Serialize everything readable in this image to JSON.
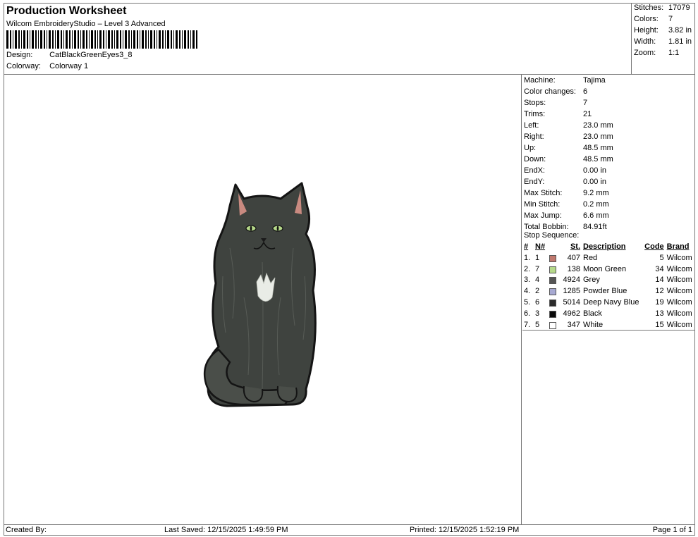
{
  "header": {
    "title": "Production Worksheet",
    "subtitle": "Wilcom EmbroideryStudio – Level 3 Advanced",
    "design_label": "Design:",
    "design_value": "CatBlackGreenEyes3_8",
    "colorway_label": "Colorway:",
    "colorway_value": "Colorway 1"
  },
  "summary": [
    {
      "label": "Stitches:",
      "value": "17079"
    },
    {
      "label": "Colors:",
      "value": "7"
    },
    {
      "label": "Height:",
      "value": "3.82 in"
    },
    {
      "label": "Width:",
      "value": "1.81 in"
    },
    {
      "label": "Zoom:",
      "value": "1:1"
    }
  ],
  "machine_info": [
    {
      "label": "Machine:",
      "value": "Tajima"
    },
    {
      "label": "Color changes:",
      "value": "6"
    },
    {
      "label": "Stops:",
      "value": "7"
    },
    {
      "label": "Trims:",
      "value": "21"
    },
    {
      "label": "Left:",
      "value": "23.0 mm"
    },
    {
      "label": "Right:",
      "value": "23.0 mm"
    },
    {
      "label": "Up:",
      "value": "48.5 mm"
    },
    {
      "label": "Down:",
      "value": "48.5 mm"
    },
    {
      "label": "EndX:",
      "value": "0.00 in"
    },
    {
      "label": "EndY:",
      "value": "0.00 in"
    },
    {
      "label": "Max Stitch:",
      "value": "9.2 mm"
    },
    {
      "label": "Min Stitch:",
      "value": "0.2 mm"
    },
    {
      "label": "Max Jump:",
      "value": "6.6 mm"
    },
    {
      "label": "Total Bobbin:",
      "value": "84.91ft"
    }
  ],
  "stop_sequence": {
    "label": "Stop Sequence:",
    "columns": {
      "idx": "#",
      "num": "N#",
      "st": "St.",
      "description": "Description",
      "code": "Code",
      "brand": "Brand"
    },
    "rows": [
      {
        "idx": "1.",
        "num": "1",
        "st": "407",
        "description": "Red",
        "code": "5",
        "brand": "Wilcom",
        "color": "#c0786e"
      },
      {
        "idx": "2.",
        "num": "7",
        "st": "138",
        "description": "Moon Green",
        "code": "34",
        "brand": "Wilcom",
        "color": "#b6d98a"
      },
      {
        "idx": "3.",
        "num": "4",
        "st": "4924",
        "description": "Grey",
        "code": "14",
        "brand": "Wilcom",
        "color": "#555555"
      },
      {
        "idx": "4.",
        "num": "2",
        "st": "1285",
        "description": "Powder Blue",
        "code": "12",
        "brand": "Wilcom",
        "color": "#a7a9d2"
      },
      {
        "idx": "5.",
        "num": "6",
        "st": "5014",
        "description": "Deep Navy Blue",
        "code": "19",
        "brand": "Wilcom",
        "color": "#2b2b2b"
      },
      {
        "idx": "6.",
        "num": "3",
        "st": "4962",
        "description": "Black",
        "code": "13",
        "brand": "Wilcom",
        "color": "#0a0a0a"
      },
      {
        "idx": "7.",
        "num": "5",
        "st": "347",
        "description": "White",
        "code": "15",
        "brand": "Wilcom",
        "color": "#ffffff"
      }
    ]
  },
  "footer": {
    "created_by": "Created By:",
    "last_saved": "Last Saved: 12/15/2025 1:49:59 PM",
    "printed": "Printed: 12/15/2025 1:52:19 PM",
    "page": "Page 1 of 1"
  }
}
